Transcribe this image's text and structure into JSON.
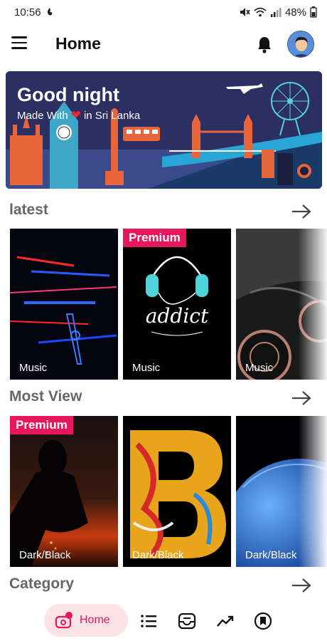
{
  "status": {
    "time": "10:56",
    "battery": "48%"
  },
  "header": {
    "title": "Home"
  },
  "banner": {
    "greeting": "Good night",
    "made_with": "Made With",
    "heart": "❤",
    "location": "in Sri Lanka"
  },
  "sections": {
    "latest": {
      "title": "latest",
      "cards": [
        {
          "label": "Music",
          "premium": ""
        },
        {
          "label": "Music",
          "premium": "Premium"
        },
        {
          "label": "Music",
          "premium": ""
        }
      ]
    },
    "most_view": {
      "title": "Most View",
      "cards": [
        {
          "label": "Dark/Black",
          "premium": "Premium"
        },
        {
          "label": "Dark/Black",
          "premium": ""
        },
        {
          "label": "Dark/Black",
          "premium": ""
        }
      ]
    },
    "category": {
      "title": "Category"
    }
  },
  "addict_text": "addict",
  "big_letter": "B",
  "bottom_nav": {
    "home_label": "Home"
  },
  "colors": {
    "accent": "#e8175d",
    "home_pill": "#fbe3e6",
    "section_title": "#666666"
  }
}
